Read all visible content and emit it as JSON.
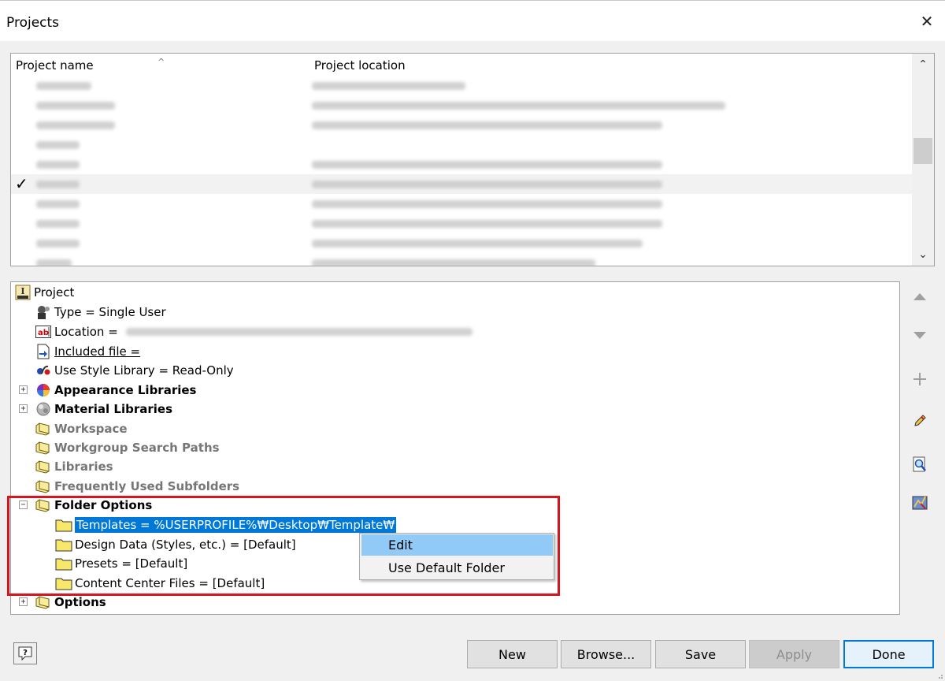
{
  "window": {
    "title": "Projects"
  },
  "project_list": {
    "columns": [
      "Project name",
      "Project location"
    ]
  },
  "tree": {
    "root": "Project",
    "type": "Type = Single User",
    "location_label": "Location =",
    "included_file": "Included file =",
    "style_library": "Use Style Library = Read-Only",
    "appearance_libraries": "Appearance Libraries",
    "material_libraries": "Material Libraries",
    "workspace": "Workspace",
    "workgroup_search_paths": "Workgroup Search Paths",
    "libraries": "Libraries",
    "frequently_used_subfolders": "Frequently Used Subfolders",
    "folder_options": "Folder Options",
    "templates": "Templates = %USERPROFILE%₩Desktop₩Template₩",
    "design_data": "Design Data (Styles, etc.) = [Default]",
    "presets": "Presets = [Default]",
    "content_center": "Content Center Files = [Default]",
    "options": "Options"
  },
  "context_menu": {
    "items": [
      "Edit",
      "Use Default Folder"
    ]
  },
  "buttons": {
    "new": "New",
    "browse": "Browse...",
    "save": "Save",
    "apply": "Apply",
    "done": "Done"
  }
}
